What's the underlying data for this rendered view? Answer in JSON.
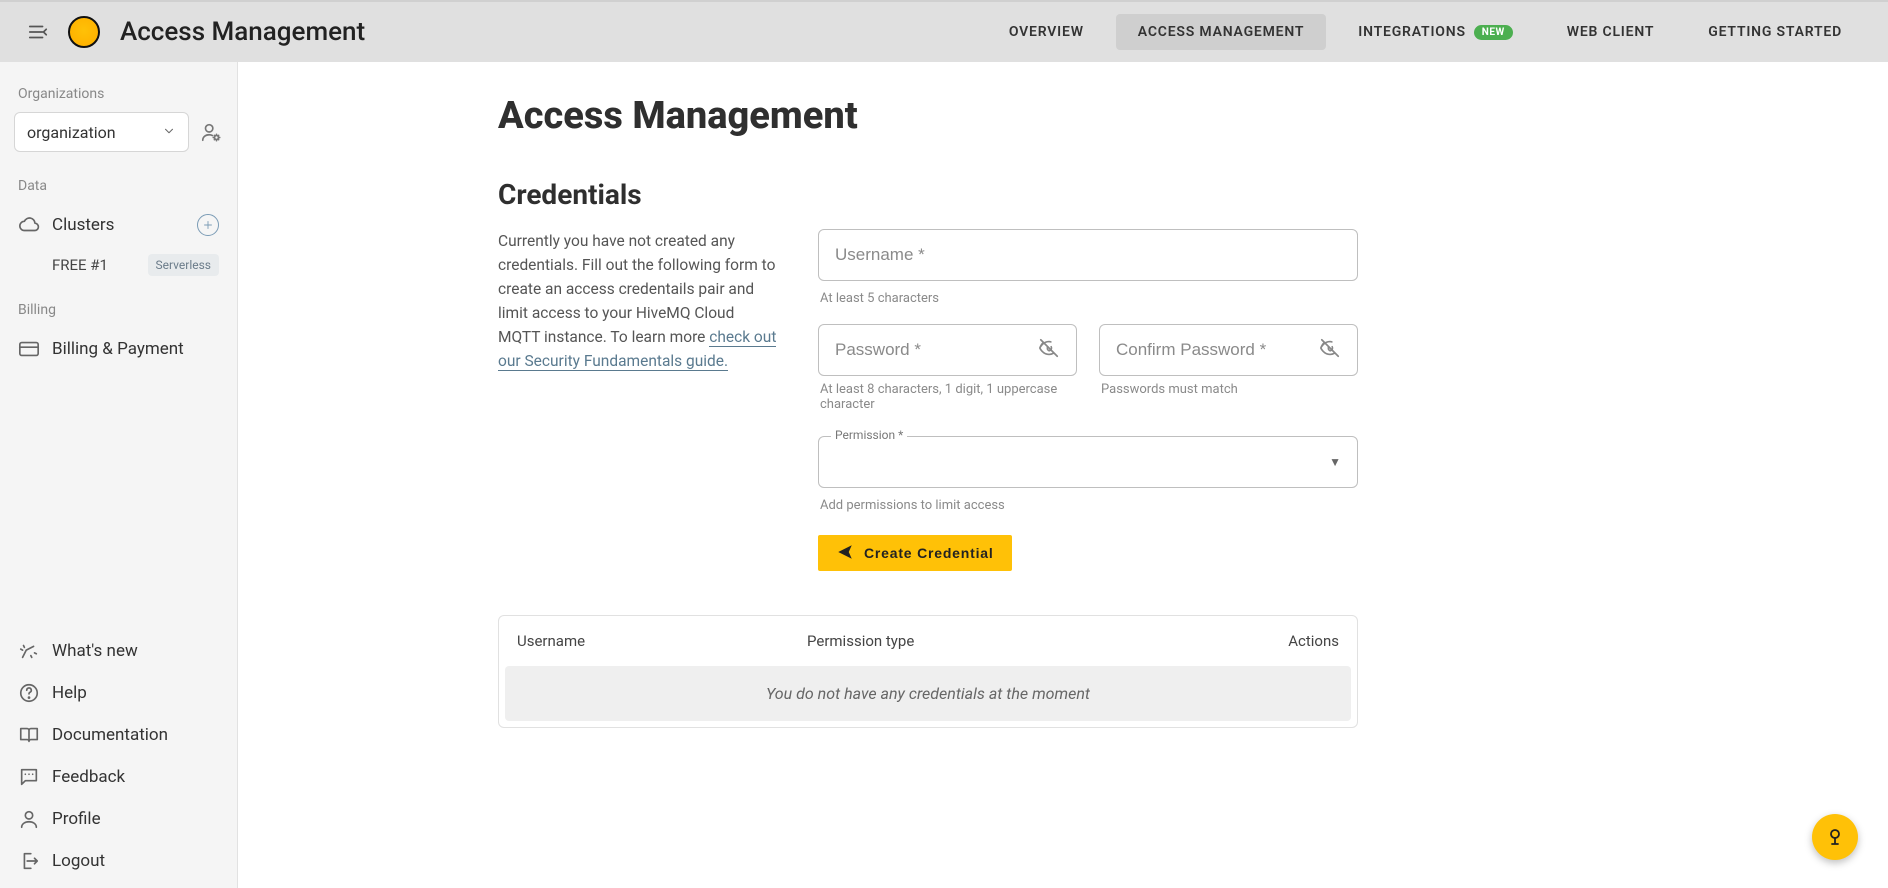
{
  "header": {
    "page_title": "Access Management",
    "nav": {
      "overview": "Overview",
      "access_management": "Access Management",
      "integrations": "Integrations",
      "integrations_badge": "NEW",
      "web_client": "Web Client",
      "getting_started": "Getting Started"
    }
  },
  "sidebar": {
    "organizations_label": "Organizations",
    "org_selected": "organization",
    "data_label": "Data",
    "clusters_label": "Clusters",
    "cluster_item": "FREE #1",
    "cluster_chip": "Serverless",
    "billing_label": "Billing",
    "billing_payment": "Billing & Payment",
    "whats_new": "What's new",
    "help": "Help",
    "documentation": "Documentation",
    "feedback": "Feedback",
    "profile": "Profile",
    "logout": "Logout"
  },
  "main": {
    "title": "Access Management",
    "credentials_title": "Credentials",
    "credentials_intro": "Currently you have not created any credentials. Fill out the following form to create an access credentails pair and limit access to your HiveMQ Cloud MQTT instance. To learn more ",
    "credentials_link": "check out our Security Fundamentals guide.",
    "form": {
      "username_placeholder": "Username *",
      "username_helper": "At least 5 characters",
      "password_placeholder": "Password *",
      "password_helper": "At least 8 characters, 1 digit, 1 uppercase character",
      "confirm_placeholder": "Confirm Password *",
      "confirm_helper": "Passwords must match",
      "permission_label": "Permission *",
      "permission_helper": "Add permissions to limit access",
      "create_button": "Create Credential"
    },
    "table": {
      "col_username": "Username",
      "col_permission": "Permission type",
      "col_actions": "Actions",
      "empty": "You do not have any credentials at the moment"
    }
  }
}
